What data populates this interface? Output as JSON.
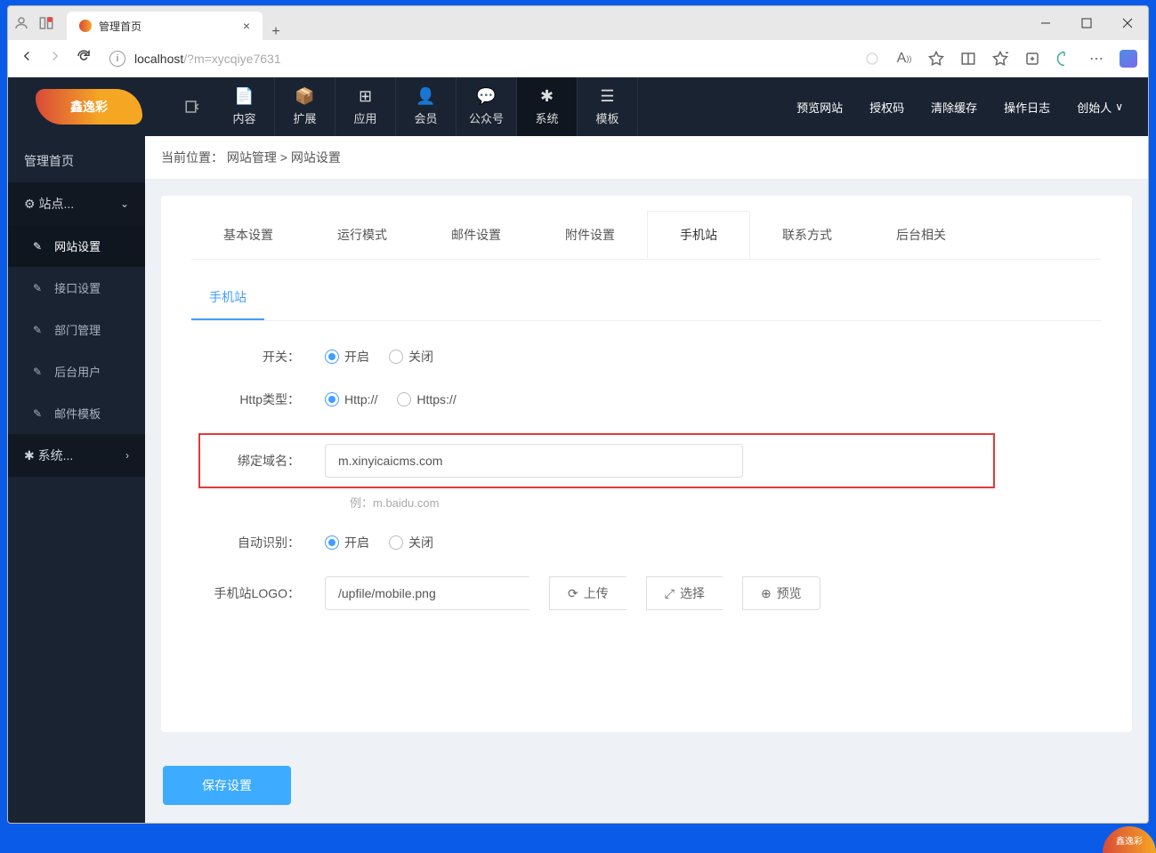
{
  "browser": {
    "tab_title": "管理首页",
    "url_host": "localhost",
    "url_path": "/?m=xycqiye7631"
  },
  "top_nav": {
    "logo_text": "鑫逸彩",
    "items": [
      {
        "label": "内容"
      },
      {
        "label": "扩展"
      },
      {
        "label": "应用"
      },
      {
        "label": "会员"
      },
      {
        "label": "公众号"
      },
      {
        "label": "系统"
      },
      {
        "label": "模板"
      }
    ],
    "right": {
      "preview": "预览网站",
      "auth_code": "授权码",
      "clear_cache": "清除缓存",
      "op_log": "操作日志",
      "founder": "创始人"
    }
  },
  "sidebar": {
    "home": "管理首页",
    "group_site": "站点...",
    "items": [
      {
        "label": "网站设置"
      },
      {
        "label": "接口设置"
      },
      {
        "label": "部门管理"
      },
      {
        "label": "后台用户"
      },
      {
        "label": "邮件模板"
      }
    ],
    "group_sys": "系统..."
  },
  "breadcrumb": {
    "prefix": "当前位置：",
    "link1": "网站管理",
    "sep": ">",
    "current": "网站设置"
  },
  "tabs": {
    "basic": "基本设置",
    "mode": "运行模式",
    "mail": "邮件设置",
    "attach": "附件设置",
    "mobile": "手机站",
    "contact": "联系方式",
    "admin": "后台相关"
  },
  "subtab": {
    "mobile": "手机站"
  },
  "form": {
    "switch_label": "开关：",
    "switch_on": "开启",
    "switch_off": "关闭",
    "http_label": "Http类型：",
    "http_opt1": "Http://",
    "http_opt2": "Https://",
    "domain_label": "绑定域名：",
    "domain_value": "m.xinyicaicms.com",
    "domain_hint": "例：m.baidu.com",
    "auto_label": "自动识别：",
    "logo_label": "手机站LOGO：",
    "logo_value": "/upfile/mobile.png",
    "upload_btn": "上传",
    "select_btn": "选择",
    "preview_btn": "预览",
    "save_btn": "保存设置"
  },
  "corner_logo": "鑫逸彩"
}
